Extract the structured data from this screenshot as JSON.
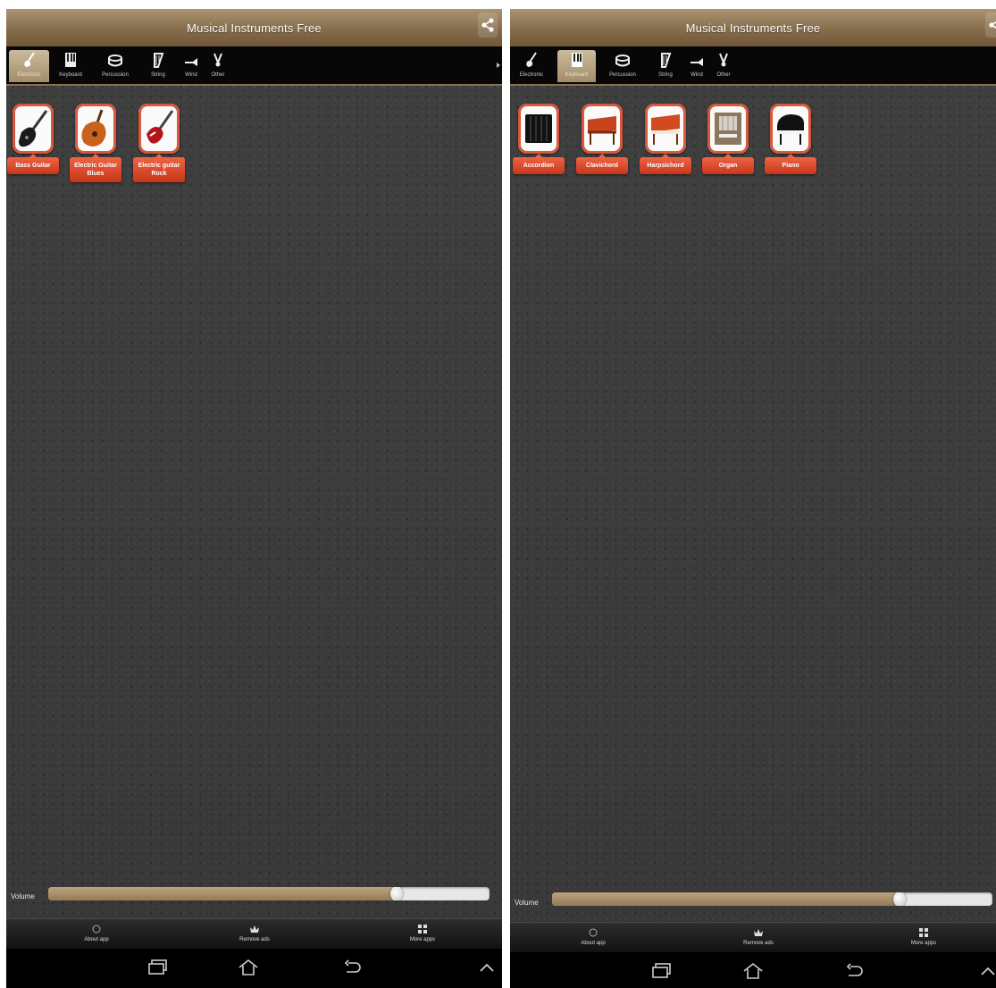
{
  "app_title": "Musical Instruments Free",
  "tabs": [
    {
      "label": "Electronic",
      "icon": "electric-guitar-icon"
    },
    {
      "label": "Keyboard",
      "icon": "keyboard-icon"
    },
    {
      "label": "Percussion",
      "icon": "drum-icon"
    },
    {
      "label": "String",
      "icon": "harp-icon"
    },
    {
      "label": "Wind",
      "icon": "trumpet-icon"
    },
    {
      "label": "Other",
      "icon": "misc-instrument-icon"
    }
  ],
  "screens": [
    {
      "active_tab": "Electronic",
      "instruments": [
        {
          "label": "Bass Guitar",
          "icon": "bass-guitar-icon"
        },
        {
          "label": "Electric Guitar Blues",
          "icon": "blues-guitar-icon"
        },
        {
          "label": "Electric guitar Rock",
          "icon": "rock-guitar-icon"
        }
      ],
      "volume_level": 0.79
    },
    {
      "active_tab": "Keyboard",
      "instruments": [
        {
          "label": "Accordion",
          "icon": "accordion-icon"
        },
        {
          "label": "Clavichord",
          "icon": "clavichord-icon"
        },
        {
          "label": "Harpsichord",
          "icon": "harpsichord-icon"
        },
        {
          "label": "Organ",
          "icon": "organ-icon"
        },
        {
          "label": "Piano",
          "icon": "grand-piano-icon"
        }
      ],
      "volume_level": 0.79
    }
  ],
  "volume_label": "Volume",
  "bottom_actions": [
    {
      "label": "About app",
      "icon": "info-icon"
    },
    {
      "label": "Remove ads",
      "icon": "crown-icon"
    },
    {
      "label": "More apps",
      "icon": "grid-icon"
    }
  ],
  "system_nav": [
    "recent-apps-icon",
    "home-icon",
    "back-icon",
    "chevron-up-icon"
  ],
  "colors": {
    "title_bar": "#866d4b",
    "tab_bar": "#070707",
    "active_tab": "#b8a582",
    "instrument_label": "#d9573a",
    "volume_fill": "#a8906a",
    "background": "#3c3c3c"
  }
}
